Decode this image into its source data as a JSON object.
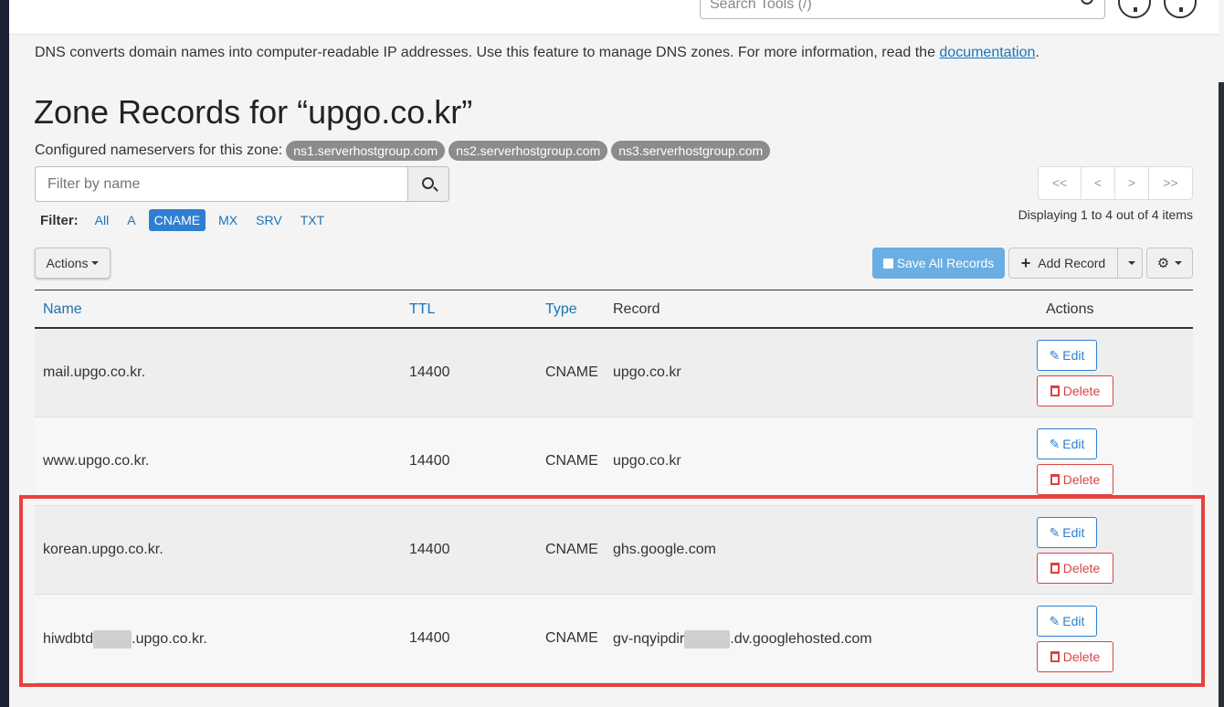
{
  "top": {
    "search_placeholder": "Search Tools (/)",
    "notifications_icon": "bell-icon",
    "user_icon": "user-icon"
  },
  "intro": {
    "text": "DNS converts domain names into computer-readable IP addresses. Use this feature to manage DNS zones. For more information, read the ",
    "link": "documentation",
    "suffix": "."
  },
  "page_title": "Zone Records for “upgo.co.kr”",
  "nameservers": {
    "label": "Configured nameservers for this zone:",
    "items": [
      "ns1.serverhostgroup.com",
      "ns2.serverhostgroup.com",
      "ns3.serverhostgroup.com"
    ]
  },
  "filter": {
    "placeholder": "Filter by name",
    "label": "Filter:",
    "options": [
      "All",
      "A",
      "CNAME",
      "MX",
      "SRV",
      "TXT"
    ],
    "active": "CNAME"
  },
  "pagination": {
    "first": "<<",
    "prev": "<",
    "next": ">",
    "last": ">>",
    "displaying": "Displaying 1 to 4 out of 4 items"
  },
  "toolbar": {
    "actions_label": "Actions",
    "save_label": "Save All Records",
    "add_label": "Add Record",
    "settings_icon": "gear-icon"
  },
  "table": {
    "headers": {
      "name": "Name",
      "ttl": "TTL",
      "type": "Type",
      "record": "Record",
      "actions": "Actions"
    },
    "edit_label": "Edit",
    "delete_label": "Delete",
    "rows": [
      {
        "name": "mail.upgo.co.kr.",
        "ttl": "14400",
        "type": "CNAME",
        "record": "upgo.co.kr"
      },
      {
        "name": "www.upgo.co.kr.",
        "ttl": "14400",
        "type": "CNAME",
        "record": "upgo.co.kr"
      },
      {
        "name": "korean.upgo.co.kr.",
        "ttl": "14400",
        "type": "CNAME",
        "record": "ghs.google.com"
      },
      {
        "name_prefix": "hiwdbtd",
        "name_suffix": ".upgo.co.kr.",
        "ttl": "14400",
        "type": "CNAME",
        "record_prefix": "gv-nqyipdir",
        "record_suffix": ".dv.googlehosted.com"
      }
    ]
  },
  "colors": {
    "accent": "#2f7fd1",
    "danger": "#d64545",
    "highlight": "#e8403f"
  }
}
